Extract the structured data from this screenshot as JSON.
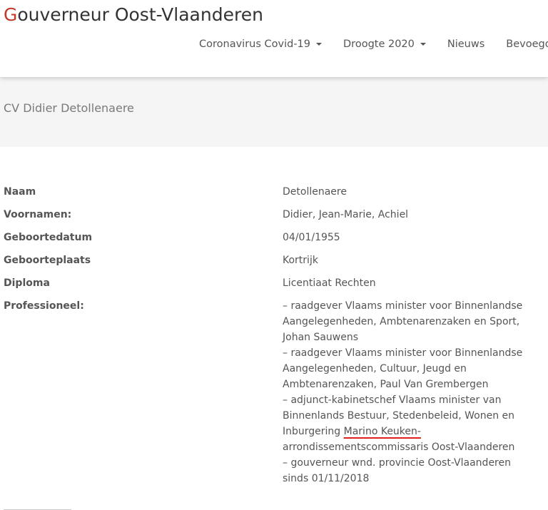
{
  "site": {
    "logo_first": "G",
    "logo_rest": "ouverneur Oost-Vlaanderen"
  },
  "nav": {
    "items": [
      {
        "label": "Coronavirus Covid-19",
        "dropdown": true
      },
      {
        "label": "Droogte 2020",
        "dropdown": true
      },
      {
        "label": "Nieuws",
        "dropdown": false
      },
      {
        "label": "Bevoegdh",
        "dropdown": false
      }
    ]
  },
  "page": {
    "title": "CV Didier Detollenaere"
  },
  "cv": {
    "naam_label": "Naam",
    "naam_value": "Detollenaere",
    "voornamen_label": "Voornamen:",
    "voornamen_value": "Didier, Jean-Marie, Achiel",
    "geboortedatum_label": "Geboortedatum",
    "geboortedatum_value": "04/01/1955",
    "geboorteplaats_label": "Geboorteplaats",
    "geboorteplaats_value": "Kortrijk",
    "diploma_label": "Diploma",
    "diploma_value": "Licentiaat Rechten",
    "professioneel_label": "Professioneel:",
    "professioneel_lines": [
      "– raadgever Vlaams minister voor Binnenlandse",
      "Aangelegenheden, Ambtenarenzaken en Sport,",
      "Johan Sauwens",
      "– raadgever Vlaams minister voor Binnenlandse",
      "Aangelegenheden, Cultuur, Jeugd en",
      "Ambtenarenzaken, Paul Van Grembergen",
      "– adjunct-kabinetschef Vlaams minister van",
      "Binnenlands Bestuur, Stedenbeleid, Wonen en",
      "Inburgering ",
      "Marino Keuken-",
      "arrondissementscommissaris Oost-Vlaanderen",
      "– gouverneur wnd. provincie Oost-Vlaanderen",
      "sinds 01/11/2018"
    ]
  },
  "colors": {
    "logo_accent": "#c0392b",
    "underline_accent": "#e0201a"
  }
}
